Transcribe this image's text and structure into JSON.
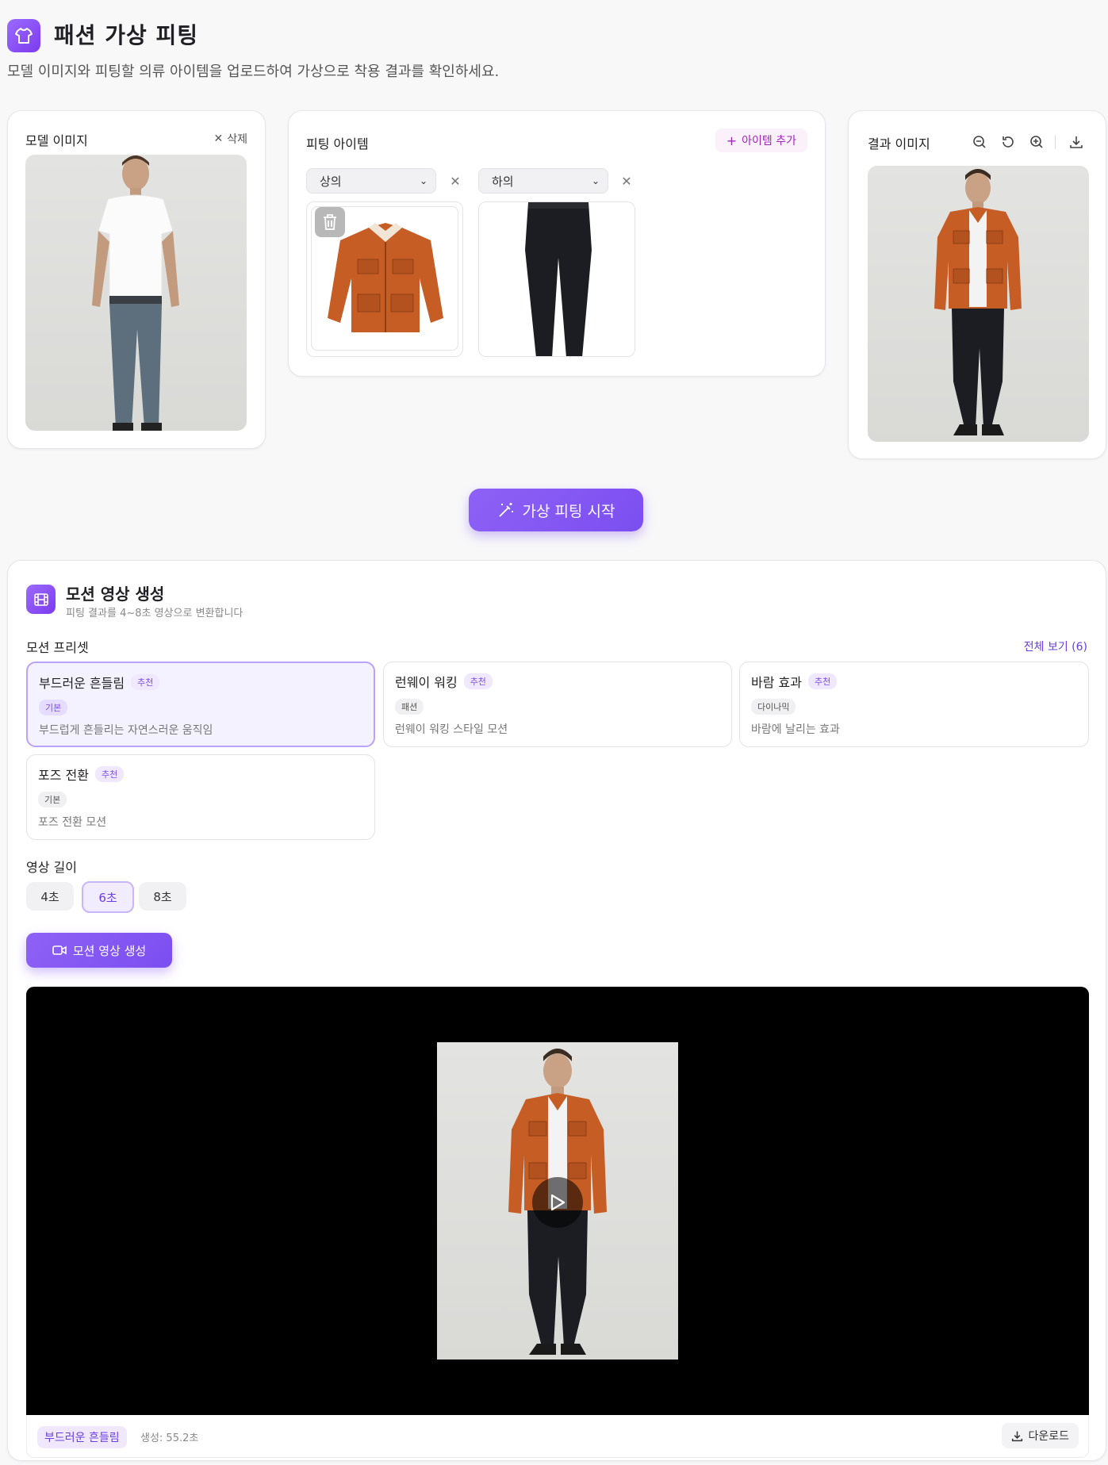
{
  "header": {
    "title": "패션 가상 피팅",
    "subtitle": "모델 이미지와 피팅할 의류 아이템을 업로드하여 가상으로 착용 결과를 확인하세요."
  },
  "model_panel": {
    "title": "모델 이미지",
    "delete_label": "삭제"
  },
  "items_panel": {
    "title": "피팅 아이템",
    "add_label": "아이템 추가",
    "items": [
      {
        "category": "상의"
      },
      {
        "category": "하의"
      }
    ]
  },
  "result_panel": {
    "title": "결과 이미지"
  },
  "start_button": "가상 피팅 시작",
  "motion": {
    "title": "모션 영상 생성",
    "subtitle": "피팅 결과를 4~8초 영상으로 변환합니다",
    "presets_label": "모션 프리셋",
    "view_all": "전체 보기 (6)",
    "presets": [
      {
        "name": "부드러운 흔들림",
        "rec": "추천",
        "category": "기본",
        "desc": "부드럽게 흔들리는 자연스러운 움직임"
      },
      {
        "name": "런웨이 워킹",
        "rec": "추천",
        "category": "패션",
        "desc": "런웨이 워킹 스타일 모션"
      },
      {
        "name": "바람 효과",
        "rec": "추천",
        "category": "다이나믹",
        "desc": "바람에 날리는 효과"
      },
      {
        "name": "포즈 전환",
        "rec": "추천",
        "category": "기본",
        "desc": "포즈 전환 모션"
      }
    ],
    "duration_label": "영상 길이",
    "durations": [
      "4초",
      "6초",
      "8초"
    ],
    "generate_label": "모션 영상 생성",
    "video": {
      "preset_tag": "부드러운 흔들림",
      "gen_time": "생성: 55.2초",
      "download_label": "다운로드"
    }
  },
  "colors": {
    "accent": "#7c4ee6",
    "jacket": "#c65d24",
    "pants": "#1c1d22"
  }
}
